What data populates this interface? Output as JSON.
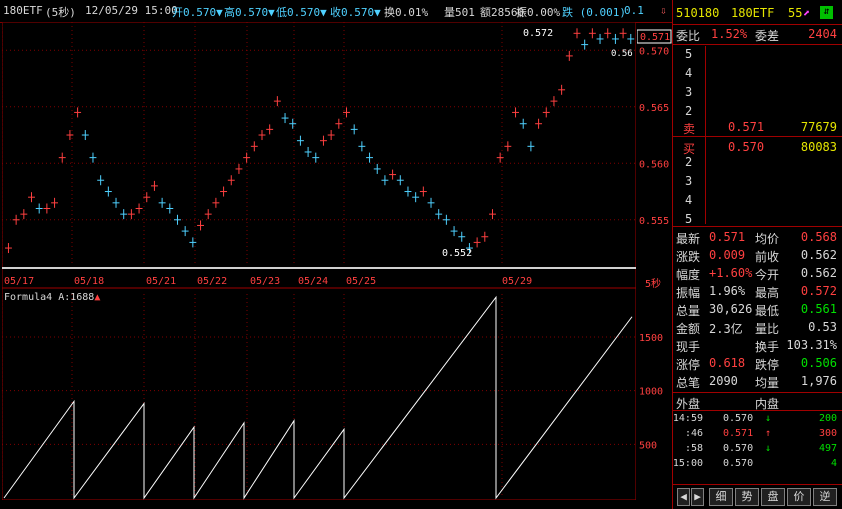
{
  "header": {
    "symbol": "180ETF",
    "period": "(5秒)",
    "datetime": "12/05/29 15:00",
    "open": "开0.570▼",
    "high": "高0.570▼",
    "low": "低0.570▼",
    "close": "收0.570▼",
    "turnover": "换0.01%",
    "volume": "量501",
    "amount": "额28560",
    "amplitude": "振0.00%",
    "change": "跌 (0.001)",
    "tail": "0.1"
  },
  "chart": {
    "price_ticks": [
      "0.570",
      "0.565",
      "0.560",
      "0.555"
    ],
    "price_current_tag": "0.571",
    "annotation_high": "0.572",
    "annotation_low": "0.552",
    "annotation_right": "0.56",
    "date_labels": [
      "05/17",
      "05/18",
      "05/21",
      "05/22",
      "05/23",
      "05/24",
      "05/25",
      "05/29"
    ],
    "period_tag": "5秒",
    "indicator_label": "Formula4",
    "indicator_value": "A:1688",
    "indicator_arrow": "▲",
    "indicator_ticks": [
      "1500",
      "1000",
      "500"
    ],
    "colors": {
      "up": "#ff4040",
      "down": "#4fd1ff",
      "grid": "#800000",
      "line": "#ffffff"
    }
  },
  "chart_data": [
    {
      "type": "line",
      "title": "180ETF (5秒)",
      "xlabel": "",
      "ylabel": "",
      "x_ticks": [
        "05/17",
        "05/18",
        "05/21",
        "05/22",
        "05/23",
        "05/24",
        "05/25",
        "05/29"
      ],
      "ylim": [
        0.551,
        0.5725
      ],
      "ticks": [
        0.57,
        0.565,
        0.56,
        0.555
      ],
      "series": [
        {
          "values": [
            0.5525,
            0.555,
            0.5555,
            0.557,
            0.556,
            0.556,
            0.5565,
            0.5605,
            0.5625,
            0.5645,
            0.5625,
            0.5605,
            0.5585,
            0.5575,
            0.5565,
            0.5555,
            0.5555,
            0.556,
            0.557,
            0.558,
            0.5565,
            0.556,
            0.555,
            0.554,
            0.553,
            0.5545,
            0.5555,
            0.5565,
            0.5575,
            0.5585,
            0.5595,
            0.5605,
            0.5615,
            0.5625,
            0.563,
            0.5655,
            0.564,
            0.5635,
            0.562,
            0.561,
            0.5605,
            0.562,
            0.5625,
            0.5635,
            0.5645,
            0.563,
            0.5615,
            0.5605,
            0.5595,
            0.5585,
            0.559,
            0.5585,
            0.5575,
            0.557,
            0.5575,
            0.5565,
            0.5555,
            0.555,
            0.554,
            0.5535,
            0.5525,
            0.553,
            0.5535,
            0.5555,
            0.5605,
            0.5615,
            0.5645,
            0.5635,
            0.5615,
            0.5635,
            0.5645,
            0.5655,
            0.5665,
            0.5695,
            0.5715,
            0.5705,
            0.5715,
            0.571,
            0.5715,
            0.571,
            0.5715,
            0.571
          ]
        }
      ],
      "grid": true
    },
    {
      "type": "line",
      "title": "Formula4",
      "xlabel": "",
      "ylabel": "",
      "ylim": [
        0,
        1900
      ],
      "ticks": [
        1500,
        1000,
        500
      ],
      "series": [
        {
          "name": "A",
          "x": [
            0,
            70,
            70,
            140,
            140,
            190,
            190,
            240,
            240,
            290,
            290,
            340,
            340,
            492,
            492,
            628
          ],
          "values": [
            0,
            900,
            0,
            880,
            0,
            660,
            0,
            700,
            0,
            720,
            0,
            640,
            0,
            1870,
            0,
            1688
          ]
        }
      ],
      "grid": true
    }
  ],
  "panel": {
    "code": "510180",
    "name": "180ETF",
    "num": "55",
    "weibi_label": "委比",
    "weibi_value": "1.52%",
    "weicha_label": "委差",
    "weicha_value": "2404",
    "sell_levels": [
      "5",
      "4",
      "3",
      "2"
    ],
    "sell_label": "卖",
    "sell_price": "0.571",
    "sell_vol": "77679",
    "buy_label": "买",
    "buy_price": "0.570",
    "buy_vol": "80083",
    "buy_levels": [
      "2",
      "3",
      "4",
      "5"
    ],
    "stats": [
      {
        "l1": "最新",
        "v1": "0.571",
        "c1": "r",
        "l2": "均价",
        "v2": "0.568",
        "c2": "r"
      },
      {
        "l1": "涨跌",
        "v1": "0.009",
        "c1": "r",
        "l2": "前收",
        "v2": "0.562",
        "c2": "w"
      },
      {
        "l1": "幅度",
        "v1": "+1.60%",
        "c1": "r",
        "l2": "今开",
        "v2": "0.562",
        "c2": "w"
      },
      {
        "l1": "振幅",
        "v1": "1.96%",
        "c1": "w",
        "l2": "最高",
        "v2": "0.572",
        "c2": "r"
      },
      {
        "l1": "总量",
        "v1": "30,626",
        "c1": "w",
        "l2": "最低",
        "v2": "0.561",
        "c2": "g"
      },
      {
        "l1": "金额",
        "v1": "2.3亿",
        "c1": "w",
        "l2": "量比",
        "v2": "0.53",
        "c2": "w"
      },
      {
        "l1": "现手",
        "v1": "",
        "c1": "w",
        "l2": "换手",
        "v2": "103.31%",
        "c2": "w"
      },
      {
        "l1": "涨停",
        "v1": "0.618",
        "c1": "r",
        "l2": "跌停",
        "v2": "0.506",
        "c2": "g"
      },
      {
        "l1": "总笔",
        "v1": "2090",
        "c1": "w",
        "l2": "均量",
        "v2": "1,976",
        "c2": "w"
      }
    ],
    "outer_label": "外盘",
    "inner_label": "内盘",
    "ticks": [
      {
        "time": "14:59",
        "price": "0.570",
        "pc": "w",
        "arrow": "↓",
        "ac": "g",
        "vol": "200",
        "vc": "g"
      },
      {
        "time": ":46",
        "price": "0.571",
        "pc": "r",
        "arrow": "↑",
        "ac": "r",
        "vol": "300",
        "vc": "r"
      },
      {
        "time": ":58",
        "price": "0.570",
        "pc": "w",
        "arrow": "↓",
        "ac": "g",
        "vol": "497",
        "vc": "g"
      },
      {
        "time": "15:00",
        "price": "0.570",
        "pc": "w",
        "arrow": "",
        "ac": "w",
        "vol": "4",
        "vc": "g"
      }
    ],
    "tabs": [
      "细",
      "势",
      "盘",
      "价",
      "逆"
    ]
  }
}
